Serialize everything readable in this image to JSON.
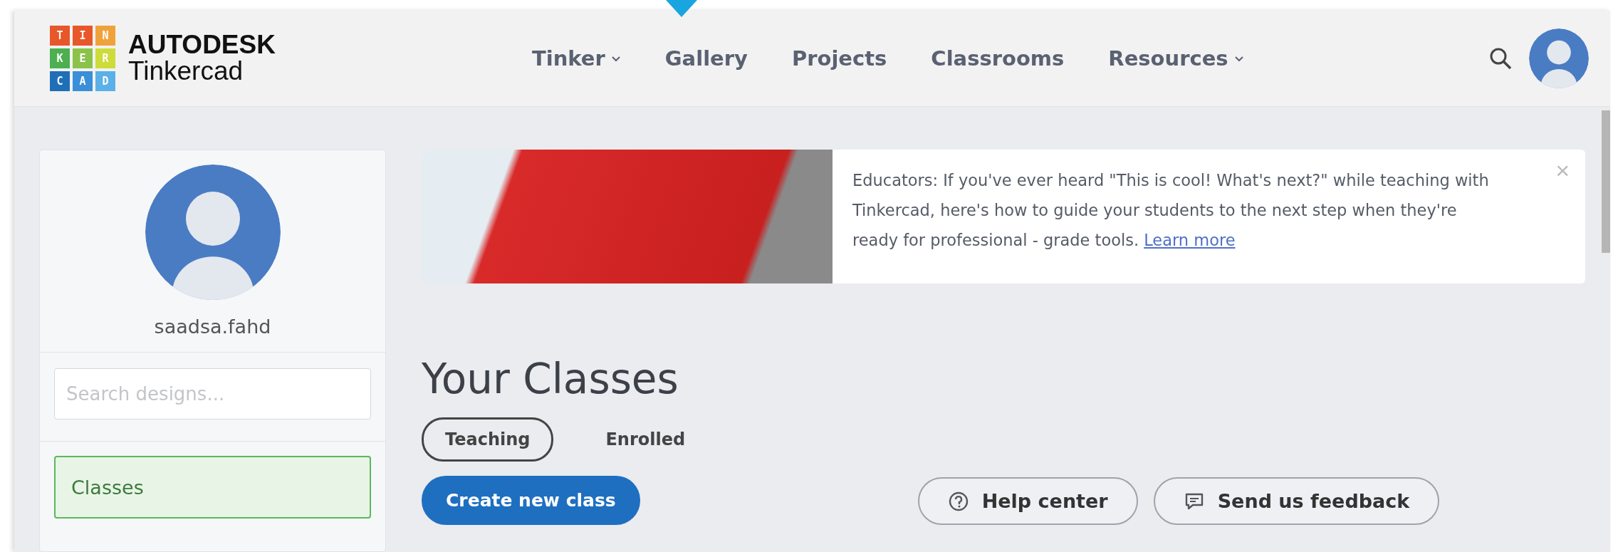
{
  "logo": {
    "tiles": [
      {
        "letter": "T",
        "color": "#e8572a"
      },
      {
        "letter": "I",
        "color": "#e8572a"
      },
      {
        "letter": "N",
        "color": "#f0a23a"
      },
      {
        "letter": "K",
        "color": "#4caf50"
      },
      {
        "letter": "E",
        "color": "#8bc34a"
      },
      {
        "letter": "R",
        "color": "#cddc39"
      },
      {
        "letter": "C",
        "color": "#1e6fb8"
      },
      {
        "letter": "A",
        "color": "#3a8fd8"
      },
      {
        "letter": "D",
        "color": "#5bb0e8"
      }
    ],
    "brand": "AUTODESK",
    "product": "Tinkercad"
  },
  "nav": [
    {
      "label": "Tinker",
      "dropdown": true
    },
    {
      "label": "Gallery",
      "dropdown": false
    },
    {
      "label": "Projects",
      "dropdown": false
    },
    {
      "label": "Classrooms",
      "dropdown": false
    },
    {
      "label": "Resources",
      "dropdown": true
    }
  ],
  "profile": {
    "username": "saadsa.fahd"
  },
  "search": {
    "placeholder": "Search designs..."
  },
  "sidebar": {
    "items": [
      {
        "label": "Classes",
        "selected": true
      }
    ]
  },
  "banner": {
    "text": "Educators: If you've ever heard \"This is cool! What's next?\" while teaching with Tinkercad, here's how to guide your students to the next step when they're ready for professional - grade tools.",
    "link": "Learn more",
    "close": "×"
  },
  "heading": "Your Classes",
  "tabs": [
    {
      "label": "Teaching",
      "selected": true
    },
    {
      "label": "Enrolled",
      "selected": false
    }
  ],
  "create_button": "Create new class",
  "footer_buttons": [
    {
      "kind": "help",
      "label": "Help center"
    },
    {
      "kind": "feedback",
      "label": "Send us feedback"
    }
  ]
}
